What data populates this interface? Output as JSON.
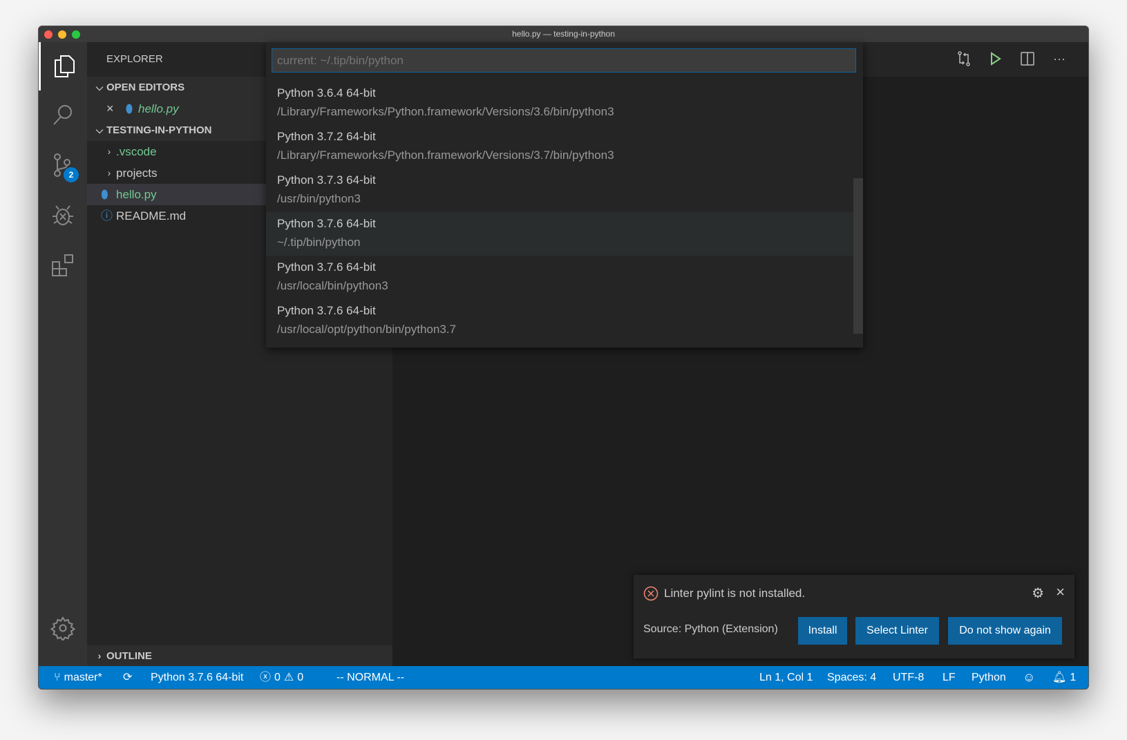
{
  "window": {
    "title": "hello.py — testing-in-python"
  },
  "activity_bar": {
    "scm_badge": "2"
  },
  "sidebar": {
    "title": "EXPLORER",
    "open_editors": {
      "label": "OPEN EDITORS",
      "items": [
        {
          "name": "hello.py"
        }
      ]
    },
    "folder": {
      "label": "TESTING-IN-PYTHON",
      "items": [
        {
          "name": ".vscode"
        },
        {
          "name": "projects"
        },
        {
          "name": "hello.py"
        },
        {
          "name": "README.md"
        }
      ]
    },
    "outline": "OUTLINE"
  },
  "quick_pick": {
    "placeholder": "current: ~/.tip/bin/python",
    "items": [
      {
        "title": "Python 3.6.4 64-bit",
        "path": "/Library/Frameworks/Python.framework/Versions/3.6/bin/python3"
      },
      {
        "title": "Python 3.7.2 64-bit",
        "path": "/Library/Frameworks/Python.framework/Versions/3.7/bin/python3"
      },
      {
        "title": "Python 3.7.3 64-bit",
        "path": "/usr/bin/python3"
      },
      {
        "title": "Python 3.7.6 64-bit",
        "path": "~/.tip/bin/python"
      },
      {
        "title": "Python 3.7.6 64-bit",
        "path": "/usr/local/bin/python3"
      },
      {
        "title": "Python 3.7.6 64-bit",
        "path": "/usr/local/opt/python/bin/python3.7"
      }
    ]
  },
  "notification": {
    "message": "Linter pylint is not installed.",
    "source": "Source: Python (Extension)",
    "buttons": [
      "Install",
      "Select Linter",
      "Do not show again"
    ]
  },
  "status_bar": {
    "branch": "master*",
    "interpreter": "Python 3.7.6 64-bit",
    "errors": "0",
    "warnings": "0",
    "mode": "-- NORMAL --",
    "position": "Ln 1, Col 1",
    "spaces": "Spaces: 4",
    "encoding": "UTF-8",
    "eol": "LF",
    "language": "Python",
    "notifications": "1"
  },
  "colors": {
    "accent": "#007acc",
    "button": "#0e639c",
    "run": "#89d185",
    "python_file": "#73c991",
    "error": "#f48771"
  }
}
